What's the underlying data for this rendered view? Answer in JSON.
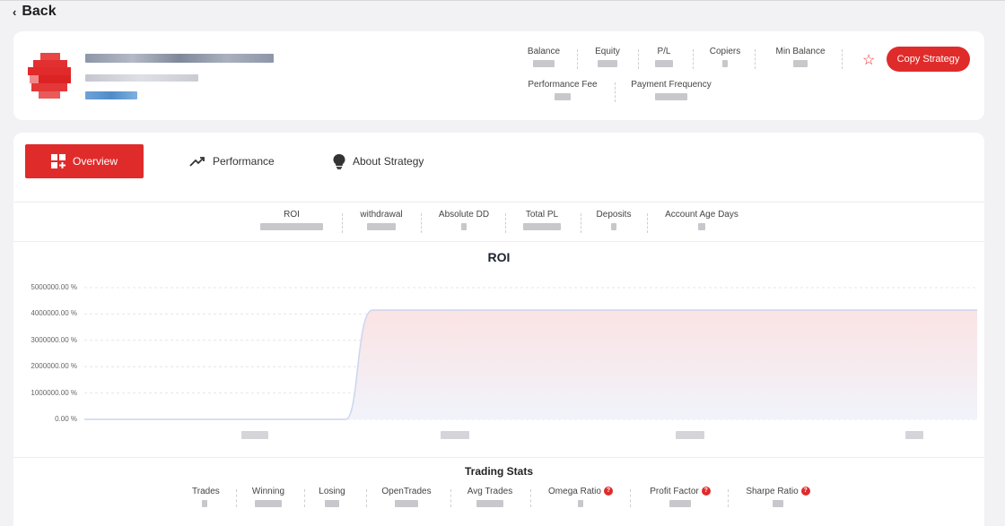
{
  "nav": {
    "back_label": "Back"
  },
  "profile": {
    "stats_row1": [
      {
        "label": "Balance"
      },
      {
        "label": "Equity"
      },
      {
        "label": "P/L"
      },
      {
        "label": "Copiers"
      },
      {
        "label": "Min Balance"
      }
    ],
    "stats_row2": [
      {
        "label": "Performance Fee"
      },
      {
        "label": "Payment Frequency"
      }
    ],
    "copy_button": "Copy Strategy",
    "favorite_icon": "star-outline-icon"
  },
  "tabs": [
    {
      "label": "Overview",
      "icon": "dashboard-add-icon",
      "active": true
    },
    {
      "label": "Performance",
      "icon": "trending-up-icon",
      "active": false
    },
    {
      "label": "About Strategy",
      "icon": "lightbulb-icon",
      "active": false
    }
  ],
  "summary": [
    {
      "label": "ROI"
    },
    {
      "label": "withdrawal"
    },
    {
      "label": "Absolute DD"
    },
    {
      "label": "Total PL"
    },
    {
      "label": "Deposits"
    },
    {
      "label": "Account Age Days"
    }
  ],
  "chart_data": {
    "type": "area",
    "title": "ROI",
    "y_ticks": [
      "5000000.00 %",
      "4000000.00 %",
      "3000000.00 %",
      "2000000.00 %",
      "1000000.00 %",
      "0.00 %"
    ],
    "ylim": [
      0,
      5000000
    ],
    "series": [
      {
        "values": [
          0,
          0,
          0,
          4150000,
          4150000,
          4150000,
          4150000,
          4150000,
          4150000,
          4150000
        ]
      }
    ],
    "grid": true,
    "colors": {
      "line": "#c9d6f2",
      "fill_top": "#fbe3e3",
      "fill_bottom": "#f1f3fb"
    }
  },
  "trading_stats": {
    "title": "Trading Stats",
    "items": [
      {
        "label": "Trades",
        "help": false
      },
      {
        "label": "Winning",
        "help": false
      },
      {
        "label": "Losing",
        "help": false
      },
      {
        "label": "OpenTrades",
        "help": false
      },
      {
        "label": "Avg Trades",
        "help": false
      },
      {
        "label": "Omega Ratio",
        "help": true
      },
      {
        "label": "Profit Factor",
        "help": true
      },
      {
        "label": "Sharpe Ratio",
        "help": true
      }
    ]
  },
  "colors": {
    "accent": "#e02b2b",
    "background": "#f2f2f5"
  }
}
